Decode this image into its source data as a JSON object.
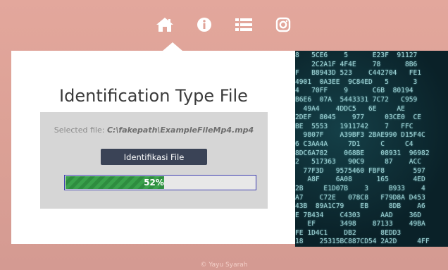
{
  "nav": {
    "items": [
      {
        "icon": "home-icon",
        "active": true
      },
      {
        "icon": "info-icon",
        "active": false
      },
      {
        "icon": "list-icon",
        "active": false
      },
      {
        "icon": "instagram-icon",
        "active": false
      }
    ]
  },
  "main": {
    "title": "Identification Type File",
    "selected_file_label": "Selected file:",
    "selected_file_path": "C:\\fakepath\\ExampleFileMp4.mp4",
    "button_label": "Identifikasi File",
    "progress_value": 52,
    "progress_label": "52%"
  },
  "matrix_lines": [
    "8   5CE6    5      E23F  91127",
    "    2C2A1F 4F4E    78      8B6",
    "F   B8943D 523    C442704   FE1",
    "4901  0A3EE  9C84ED   5      3",
    "4   70FF    9      C6B  80194",
    "B6E6  07A  5443331 7C72   C959",
    "  49A4    4DDC5   6E     AE",
    "2DEF  8045    977     03CE0  CE",
    "BE  5553   1911742    7   FFC",
    "  9807F    A39BF3 2BAE990 D15F4C",
    "6 C3AA4A     7D1     C     C4",
    "8DC6A782    068BE    08931  96982",
    "2   517363   90C9     87    ACC",
    "  77F3D   9575460 FBF8       597",
    "   A8F    6A08      165      4ED",
    "2B     E1D07B    3     B933    4",
    "A7    C72E   078C8   F79D8A D453",
    "43B  89A1C79    EB     8DB    A6",
    "E 7B434    C4303     AAD    36D",
    "   EF      3498    87133    49BA",
    "FE 1D4C1    DB2      8EDD3",
    "18    25315BC887CD54 2A2D     4FF"
  ],
  "footer": {
    "text": "© Yayu Syarah"
  },
  "colors": {
    "button": "#3a4356",
    "progress_fill": "#3aa24c",
    "progress_border": "#3f3fb0"
  }
}
